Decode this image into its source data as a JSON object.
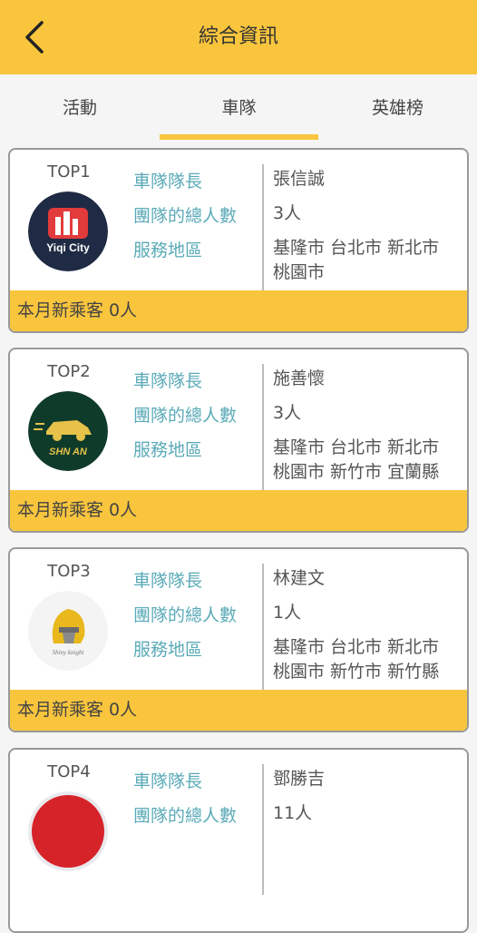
{
  "header": {
    "title": "綜合資訊"
  },
  "tabs": [
    "活動",
    "車隊",
    "英雄榜"
  ],
  "labels": {
    "captain": "車隊隊長",
    "members": "團隊的總人數",
    "area": "服務地區"
  },
  "cards": [
    {
      "rank": "TOP1",
      "logo_text": "Yiqi City",
      "captain": "張信誠",
      "members": "3人",
      "area_line1": "基隆市 台北市 新北市",
      "area_line2": "桃園市",
      "footer": "本月新乘客 0人"
    },
    {
      "rank": "TOP2",
      "logo_text": "SHN AN",
      "captain": "施善懷",
      "members": "3人",
      "area_line1": "基隆市 台北市 新北市",
      "area_line2": "桃園市 新竹市 宜蘭縣",
      "footer": "本月新乘客 0人"
    },
    {
      "rank": "TOP3",
      "logo_text": "Shiny knight",
      "captain": "林建文",
      "members": "1人",
      "area_line1": "基隆市 台北市 新北市",
      "area_line2": "桃園市 新竹市 新竹縣",
      "footer": "本月新乘客 0人"
    },
    {
      "rank": "TOP4",
      "captain": "鄧勝吉",
      "members": "11人"
    }
  ]
}
